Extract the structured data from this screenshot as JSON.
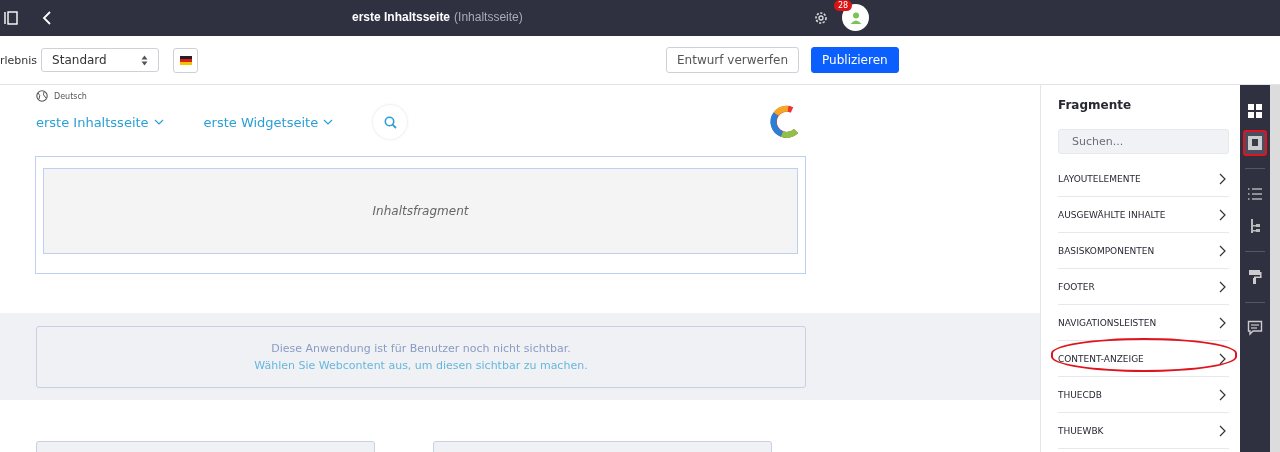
{
  "top_bar": {
    "title": "erste Inhaltsseite",
    "subtitle": "(Inhaltsseite)",
    "notification_count": "28"
  },
  "toolbar": {
    "experience_label": "rlebnis",
    "experience_value": "Standard",
    "buttons": [
      {
        "label": "Entwurf verwerfen",
        "kind": "secondary"
      },
      {
        "label": "Publizieren",
        "kind": "primary"
      }
    ]
  },
  "page": {
    "language": "Deutsch",
    "nav": [
      {
        "label": "erste Inhaltsseite"
      },
      {
        "label": "erste Widgetseite"
      }
    ],
    "fragment_placeholder": "Inhaltsfragment",
    "notice": [
      "Diese Anwendung ist für Benutzer noch nicht sichtbar.",
      "Wählen Sie Webcontent aus, um diesen sichtbar zu machen."
    ]
  },
  "panel": {
    "title": "Fragmente",
    "search": {
      "placeholder": "Suchen..."
    },
    "categories": [
      {
        "label": "LAYOUTELEMENTE",
        "highlighted": false
      },
      {
        "label": "AUSGEWÄHLTE INHALTE",
        "highlighted": false
      },
      {
        "label": "BASISKOMPONENTEN",
        "highlighted": false
      },
      {
        "label": "FOOTER",
        "highlighted": false
      },
      {
        "label": "NAVIGATIONSLEISTEN",
        "highlighted": false
      },
      {
        "label": "CONTENT-ANZEIGE",
        "highlighted": true
      },
      {
        "label": "THUECDB",
        "highlighted": false
      },
      {
        "label": "THUEWBK",
        "highlighted": false
      }
    ]
  },
  "rail": [
    {
      "kind": "grid",
      "selected": false,
      "highlighted": false
    },
    {
      "kind": "fragment",
      "selected": true,
      "highlighted": true
    },
    {
      "kind": "list",
      "selected": false,
      "highlighted": false
    },
    {
      "kind": "tree",
      "selected": false,
      "highlighted": false
    },
    {
      "kind": "roller",
      "selected": false,
      "highlighted": false
    },
    {
      "kind": "comment",
      "selected": false,
      "highlighted": false
    }
  ]
}
